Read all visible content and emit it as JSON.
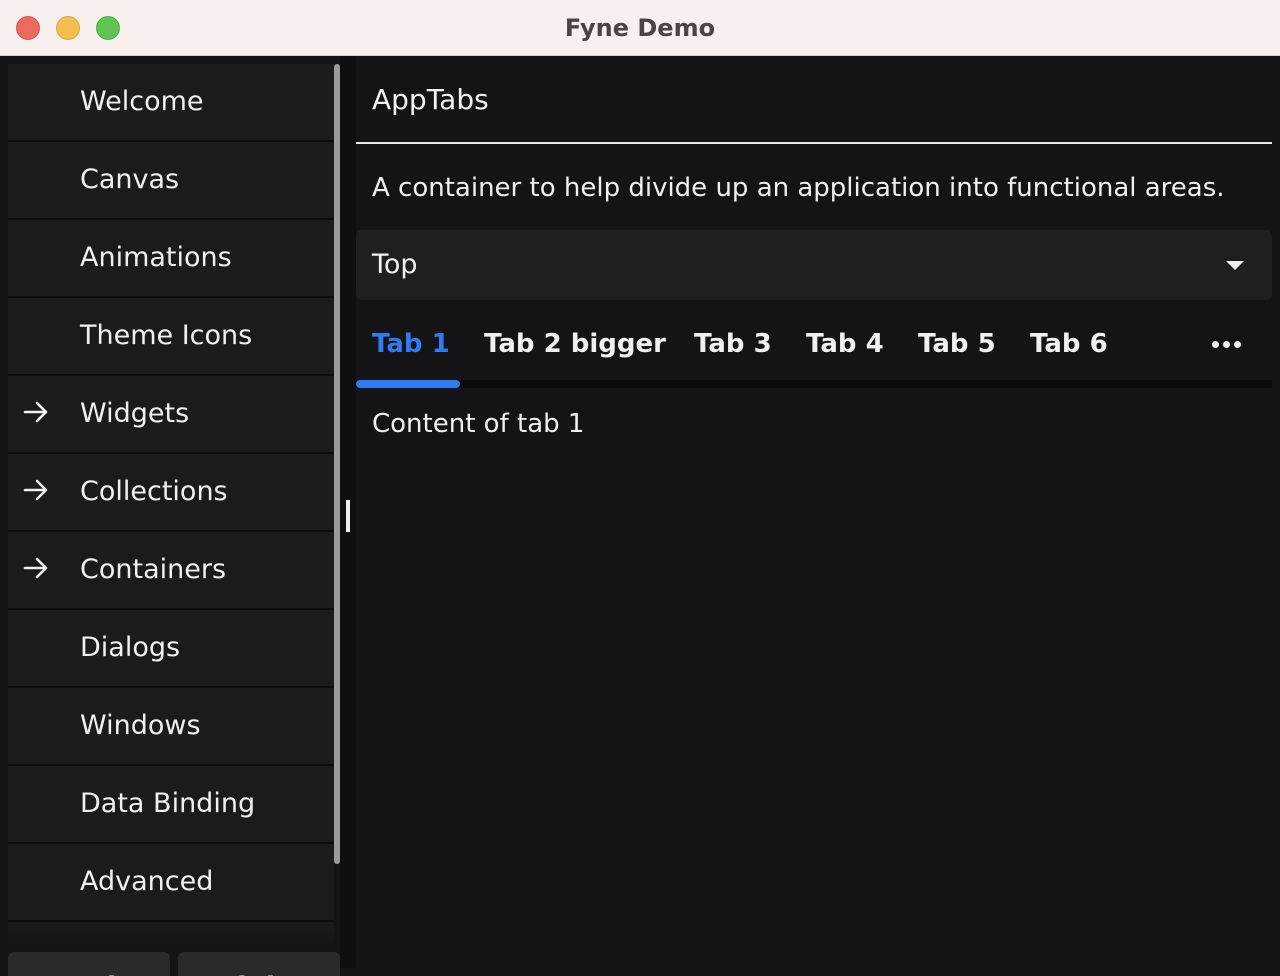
{
  "window": {
    "title": "Fyne Demo"
  },
  "sidebar": {
    "items": [
      {
        "label": "Welcome",
        "has_children": false
      },
      {
        "label": "Canvas",
        "has_children": false
      },
      {
        "label": "Animations",
        "has_children": false
      },
      {
        "label": "Theme Icons",
        "has_children": false
      },
      {
        "label": "Widgets",
        "has_children": true
      },
      {
        "label": "Collections",
        "has_children": true
      },
      {
        "label": "Containers",
        "has_children": true
      },
      {
        "label": "Dialogs",
        "has_children": false
      },
      {
        "label": "Windows",
        "has_children": false
      },
      {
        "label": "Data Binding",
        "has_children": false
      },
      {
        "label": "Advanced",
        "has_children": false
      }
    ],
    "theme_buttons": {
      "dark": "Dark",
      "light": "Light"
    }
  },
  "main": {
    "title": "AppTabs",
    "description": "A container to help divide up an application into functional areas.",
    "location_select": {
      "value": "Top"
    },
    "tabs": [
      {
        "label": "Tab 1",
        "active": true
      },
      {
        "label": "Tab 2 bigger",
        "active": false
      },
      {
        "label": "Tab 3",
        "active": false
      },
      {
        "label": "Tab 4",
        "active": false
      },
      {
        "label": "Tab 5",
        "active": false
      },
      {
        "label": "Tab 6",
        "active": false
      }
    ],
    "tab_content": "Content of tab 1"
  },
  "colors": {
    "accent": "#2f7bf2",
    "background": "#141416",
    "list_background": "#1b1b1d",
    "input_background": "#1f1f22",
    "button_background": "#2a2a2d",
    "text": "#f0f0f0"
  },
  "icons": {
    "nav_expand": "arrow-right-icon",
    "select_caret": "caret-down-icon",
    "tab_overflow": "more-horizontal-icon"
  }
}
